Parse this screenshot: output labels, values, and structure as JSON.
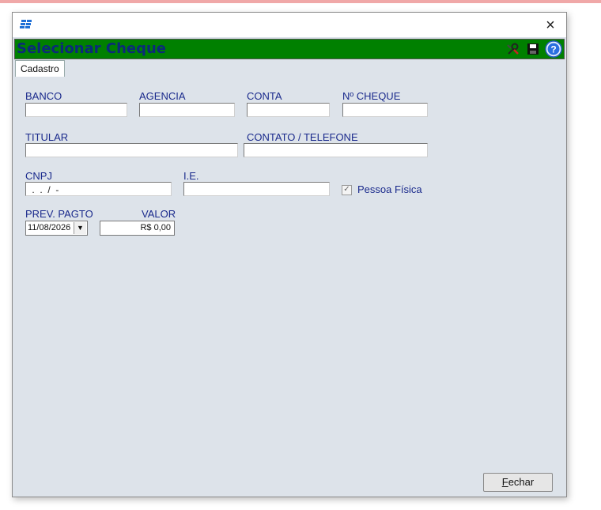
{
  "window": {
    "title": "Selecionar Cheque",
    "close_glyph": "×",
    "app_icon": "app-logo-icon"
  },
  "header": {
    "icons": [
      "tools-icon",
      "save-icon",
      "help-icon"
    ]
  },
  "tabs": [
    {
      "label": "Cadastro"
    }
  ],
  "form": {
    "banco": {
      "label": "BANCO",
      "value": ""
    },
    "agencia": {
      "label": "AGENCIA",
      "value": ""
    },
    "conta": {
      "label": "CONTA",
      "value": ""
    },
    "numero_cheque": {
      "label": "Nº CHEQUE",
      "value": ""
    },
    "titular": {
      "label": "TITULAR",
      "value": ""
    },
    "contato": {
      "label": "CONTATO / TELEFONE",
      "value": ""
    },
    "cnpj": {
      "label": "CNPJ",
      "value": " .  .  /  -"
    },
    "ie": {
      "label": "I.E.",
      "value": ""
    },
    "pessoa_fisica": {
      "label": "Pessoa Física",
      "checked": true
    },
    "prev_pagto": {
      "label": "PREV. PAGTO",
      "value": "11/08/2026"
    },
    "valor": {
      "label": "VALOR",
      "value": "R$ 0,00"
    }
  },
  "buttons": {
    "fechar_first": "F",
    "fechar_rest": "echar"
  },
  "colors": {
    "header_bg": "#008000",
    "title_text": "#0b2a7a",
    "label_text": "#1a2a8c",
    "window_bg": "#dde3ea"
  }
}
